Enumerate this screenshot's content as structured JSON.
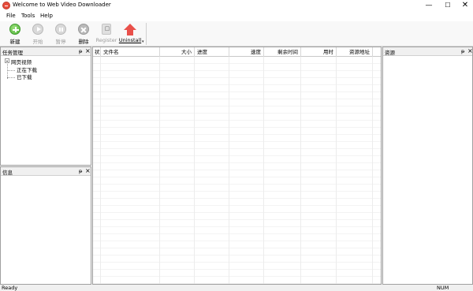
{
  "window": {
    "title": "Welcome to Web Video Downloader",
    "minimize": "—",
    "maximize": "☐",
    "close": "✕"
  },
  "menu": {
    "file": "File",
    "tools": "Tools",
    "help": "Help"
  },
  "toolbar": {
    "new_label": "新建",
    "start_label": "开始",
    "pause_label": "暂停",
    "delete_label": "删除",
    "register_label": "Register",
    "uninstall_label": "Uninstall",
    "dropdown": "▾"
  },
  "task_panel": {
    "title": "任务管理",
    "pin": "ᵽ",
    "close": "×",
    "tree": {
      "root": "网页视频",
      "children": [
        "正在下载",
        "已下载"
      ]
    }
  },
  "info_panel": {
    "title": "信息",
    "pin": "ᵽ",
    "close": "×"
  },
  "resource_panel": {
    "title": "资源",
    "pin": "ᵽ",
    "close": "×"
  },
  "grid": {
    "columns": [
      "状",
      "文件名",
      "大小",
      "进度",
      "速度",
      "剩余时间",
      "用时",
      "资源地址"
    ]
  },
  "status": {
    "text": "Ready",
    "num": "NUM"
  }
}
